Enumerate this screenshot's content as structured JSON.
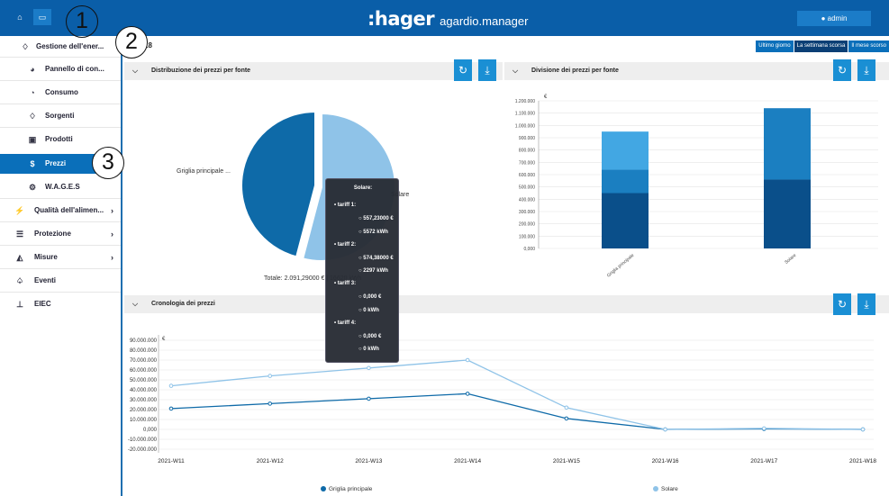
{
  "header": {
    "brand": ":hager",
    "app_name": "agardio.manager",
    "user": "admin",
    "tabs": [
      {
        "icon": "home-icon"
      },
      {
        "icon": "monitor-icon"
      }
    ]
  },
  "sidebar": {
    "items": [
      {
        "label": "Gestione dell'ener...",
        "icon": "bulb-icon"
      },
      {
        "label": "Pannello di con...",
        "icon": "pie-icon"
      },
      {
        "label": "Consumo",
        "icon": "gauge-icon"
      },
      {
        "label": "Sorgenti",
        "icon": "bulb-icon"
      },
      {
        "label": "Prodotti",
        "icon": "box-icon"
      },
      {
        "label": "Prezzi",
        "icon": "dollar-icon"
      },
      {
        "label": "W.A.G.E.S",
        "icon": "gears-icon"
      },
      {
        "label": "Qualità dell'alimen...",
        "icon": "plug-icon"
      },
      {
        "label": "Protezione",
        "icon": "sliders-icon"
      },
      {
        "label": "Misure",
        "icon": "area-chart-icon"
      },
      {
        "label": "Eventi",
        "icon": "bell-icon"
      },
      {
        "label": "EIEC",
        "icon": "sitemap-icon"
      }
    ]
  },
  "breadcrumb": "18",
  "period": {
    "options": [
      "Ultimo giorno",
      "La settimana scorsa",
      "Il mese scorso"
    ],
    "selected": "La settimana scorsa"
  },
  "panels": {
    "pie": {
      "title": "Distribuzione dei prezzi per fonte",
      "total": "Totale: 2.091,29000 € | 16620 kWh"
    },
    "bar": {
      "title": "Divisione dei prezzi per fonte"
    },
    "line": {
      "title": "Cronologia dei prezzi"
    }
  },
  "tooltip": {
    "title": "Solare:",
    "tariffs": [
      {
        "label": "tariff 1:",
        "price": "557,23000 €",
        "energy": "5572 kWh"
      },
      {
        "label": "tariff 2:",
        "price": "574,38000 €",
        "energy": "2297 kWh"
      },
      {
        "label": "tariff 3:",
        "price": "0,000 €",
        "energy": "0 kWh"
      },
      {
        "label": "tariff 4:",
        "price": "0,000 €",
        "energy": "0 kWh"
      }
    ]
  },
  "callouts": [
    "1",
    "2",
    "3"
  ],
  "colors": {
    "dark": "#0a4f8a",
    "mid": "#1b7fc1",
    "light": "#5eb8e8",
    "pale": "#8fc3e8"
  },
  "chart_data": [
    {
      "type": "pie",
      "labels": [
        "Griglia principale",
        "Solare"
      ],
      "values": [
        960,
        1131
      ]
    },
    {
      "type": "bar",
      "ylabel": "€",
      "categories": [
        "Griglia principale",
        "Solare"
      ],
      "series": [
        {
          "values": [
            450000,
            560000
          ]
        },
        {
          "values": [
            190000,
            580000
          ]
        },
        {
          "values": [
            310000,
            0
          ]
        }
      ],
      "ylim": [
        0,
        1200000
      ],
      "yticks": [
        "0,000",
        "100.000",
        "200.000",
        "300.000",
        "400.000",
        "500.000",
        "600.000",
        "700.000",
        "800.000",
        "900.000",
        "1.000.000",
        "1.100.000",
        "1.200.000"
      ]
    },
    {
      "type": "line",
      "ylabel": "€",
      "x": [
        "2021-W11",
        "2021-W12",
        "2021-W13",
        "2021-W14",
        "2021-W15",
        "2021-W16",
        "2021-W17",
        "2021-W18"
      ],
      "series": [
        {
          "name": "Griglia principale",
          "values": [
            21000000,
            26000000,
            31000000,
            36000000,
            11000000,
            0,
            500000,
            0
          ]
        },
        {
          "name": "Solare",
          "values": [
            44000000,
            54000000,
            62000000,
            70000000,
            22000000,
            0,
            1000000,
            0
          ]
        }
      ],
      "ylim": [
        -20000000,
        90000000
      ],
      "yticks": [
        "-20.000.000",
        "-10.000.000",
        "0,000",
        "10.000.000",
        "20.000.000",
        "30.000.000",
        "40.000.000",
        "50.000.000",
        "60.000.000",
        "70.000.000",
        "80.000.000",
        "90.000.000"
      ]
    }
  ]
}
